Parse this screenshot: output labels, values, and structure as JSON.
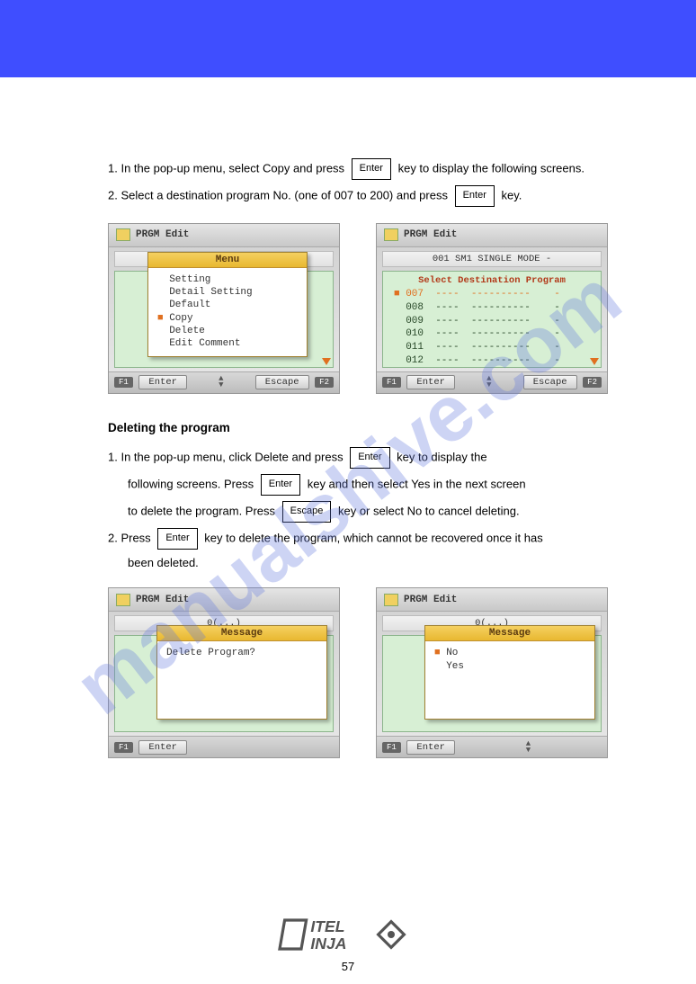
{
  "banner": {},
  "copy_section": {
    "title": "",
    "steps": {
      "s1": "1. In the pop-up menu, select Copy and press",
      "s1_key": "Enter",
      "s1_tail": "key to display the following screens.",
      "s2": "2. Select a destination program No. (one of 007 to 200) and press",
      "s2_key": "Enter",
      "s2_tail": "key."
    }
  },
  "delete_section": {
    "title": "Deleting the program",
    "steps": {
      "s1a": "1. In the pop-up menu, click Delete and press",
      "s1a_key": "Enter",
      "s1a_tail": "key to display the",
      "s1b": "following screens. Press",
      "s1b_key": "Enter",
      "s1b_tail": "key and then select Yes in the next screen",
      "s1c": "to delete the program. Press",
      "s1c_key": "Escape",
      "s1c_tail": "key or select No to cancel deleting.",
      "s2": "2. Press",
      "s2_key": "Enter",
      "s2_tail": "key to delete the program, which cannot be recovered once it has",
      "s2b": "been deleted."
    }
  },
  "screens": {
    "titlebar": "PRGM Edit",
    "progbar_left1": "0(...)",
    "progbar_right1": "001 SM1  SINGLE MODE    -",
    "f1": "F1",
    "f2": "F2",
    "enter_btn": "Enter",
    "escape_btn": "Escape",
    "menu_title": "Menu",
    "menu_items": {
      "i1": "Setting",
      "i2": "Detail Setting",
      "i3": "Default",
      "i4": "Copy",
      "i5": "Delete",
      "i6": "Edit Comment"
    },
    "dest_header": "Select Destination Program",
    "dest_list": {
      "r1": "007  ----  ----------    -",
      "r2": "008  ----  ----------    -",
      "r3": "009  ----  ----------    -",
      "r4": "010  ----  ----------    -",
      "r5": "011  ----  ----------    -",
      "r6": "012  ----  ----------    -"
    },
    "msg_title": "Message",
    "msg_q": "Delete Program?",
    "msg_no": "No",
    "msg_yes": "Yes"
  },
  "footer": {
    "page": "57",
    "logo1": "ITEL",
    "logo2": "INJA"
  },
  "watermark": "manualshive.com"
}
